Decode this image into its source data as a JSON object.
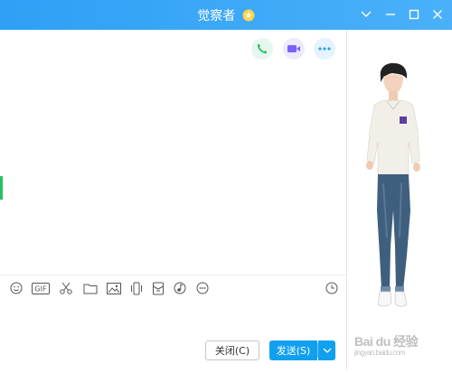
{
  "window": {
    "title": "觉察者"
  },
  "actions": {
    "close_label": "关闭(C)",
    "send_label": "发送(S)"
  },
  "watermark": {
    "text": "Bai du 经验",
    "sub": "jingyan.baidu.com"
  },
  "colors": {
    "titlebar": "#2ea0f5",
    "phone": "#2bbd6a",
    "video": "#7b61ff",
    "more": "#2aa3f0",
    "send": "#11a0f0"
  }
}
